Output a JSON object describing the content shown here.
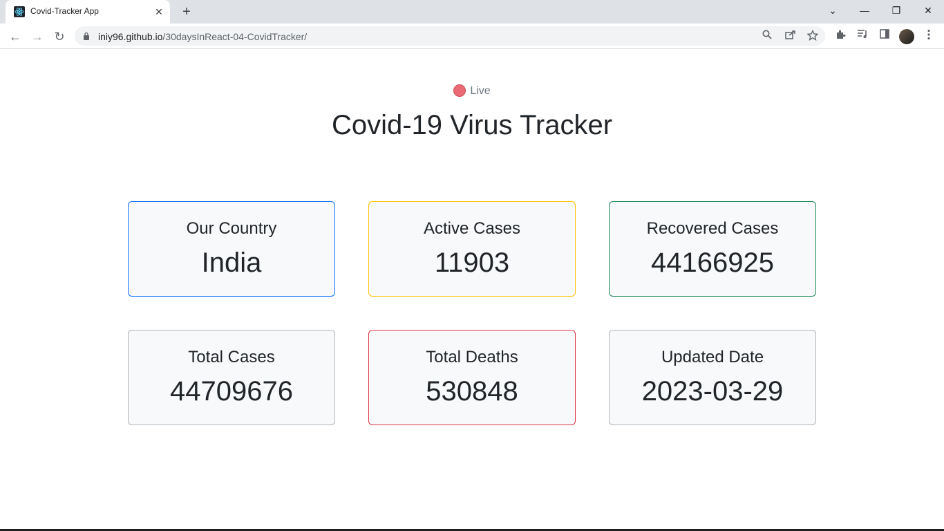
{
  "browser": {
    "tab_title": "Covid-Tracker App",
    "tab_close": "✕",
    "new_tab": "+",
    "url_host": "iniy96.github.io",
    "url_path": "/30daysInReact-04-CovidTracker/",
    "window_controls": {
      "dropdown": "⌄",
      "minimize": "—",
      "restore": "❐",
      "close": "✕"
    },
    "nav": {
      "back": "←",
      "forward": "→",
      "reload": "↻"
    },
    "icons": [
      "zoom-icon",
      "share-icon",
      "bookmark-star-icon",
      "extensions-icon",
      "media-icon",
      "side-panel-icon",
      "profile-avatar",
      "menu-icon"
    ]
  },
  "header": {
    "live_label": "Live",
    "title": "Covid-19 Virus Tracker"
  },
  "cards": [
    {
      "label": "Our Country",
      "value": "India",
      "border_color": "#0d6efd"
    },
    {
      "label": "Active Cases",
      "value": "11903",
      "border_color": "#ffc107"
    },
    {
      "label": "Recovered Cases",
      "value": "44166925",
      "border_color": "#198754"
    },
    {
      "label": "Total Cases",
      "value": "44709676",
      "border_color": "#adb5bd"
    },
    {
      "label": "Total Deaths",
      "value": "530848",
      "border_color": "#dc3545"
    },
    {
      "label": "Updated Date",
      "value": "2023-03-29",
      "border_color": "#adb5bd"
    }
  ],
  "colors": {
    "live_dot": "#ea6a75",
    "card_bg": "#f8f9fa",
    "text": "#212529"
  }
}
